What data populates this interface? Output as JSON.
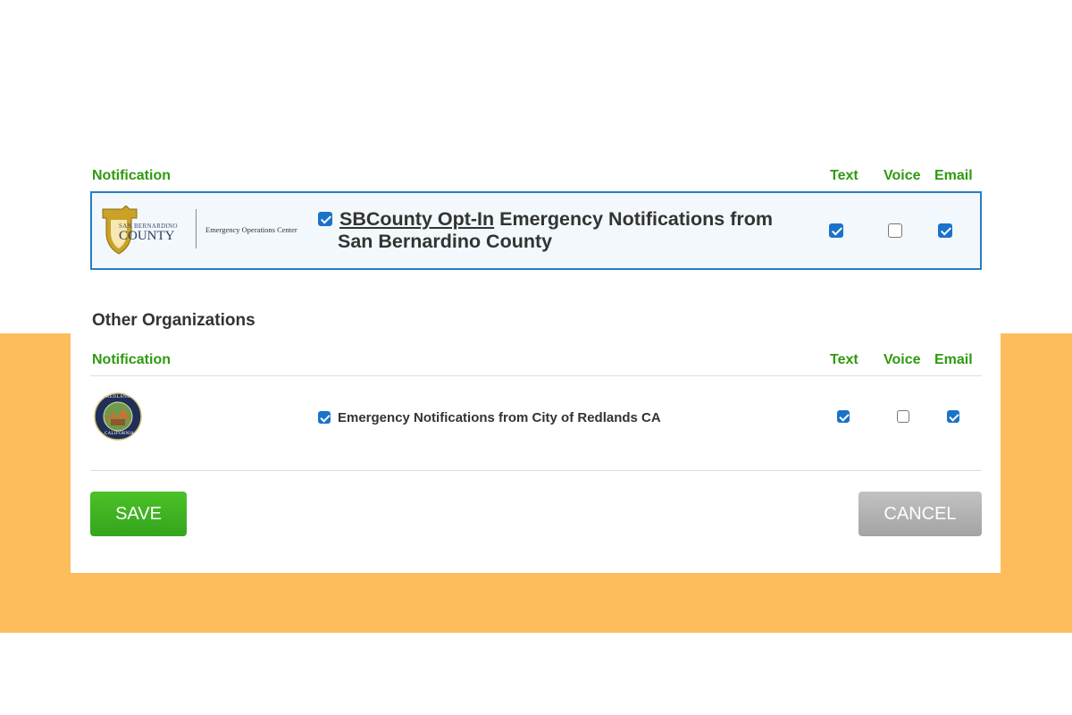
{
  "columns": {
    "notification": "Notification",
    "text": "Text",
    "voice": "Voice",
    "email": "Email"
  },
  "featured": {
    "logo": {
      "line1": "SAN BERNARDINO",
      "line2": "COUNTY",
      "subtitle": "Emergency Operations Center"
    },
    "subscribed": true,
    "link_text": "SBCounty Opt-In",
    "title_rest": " Emergency Notifications from",
    "title_line2": "San Bernardino County",
    "text": true,
    "voice": false,
    "email": true
  },
  "other": {
    "section_title": "Other Organizations",
    "items": [
      {
        "seal": {
          "top": "REDLANDS",
          "bottom": "CALIFORNIA"
        },
        "subscribed": true,
        "label": "Emergency Notifications from City of Redlands CA",
        "text": true,
        "voice": false,
        "email": true
      }
    ]
  },
  "buttons": {
    "save": "SAVE",
    "cancel": "CANCEL"
  },
  "colors": {
    "accent_green": "#2e9a0f",
    "featured_border": "#2a7cc7",
    "background_band": "#fdbd5c",
    "checkbox_blue": "#1a73c9"
  }
}
